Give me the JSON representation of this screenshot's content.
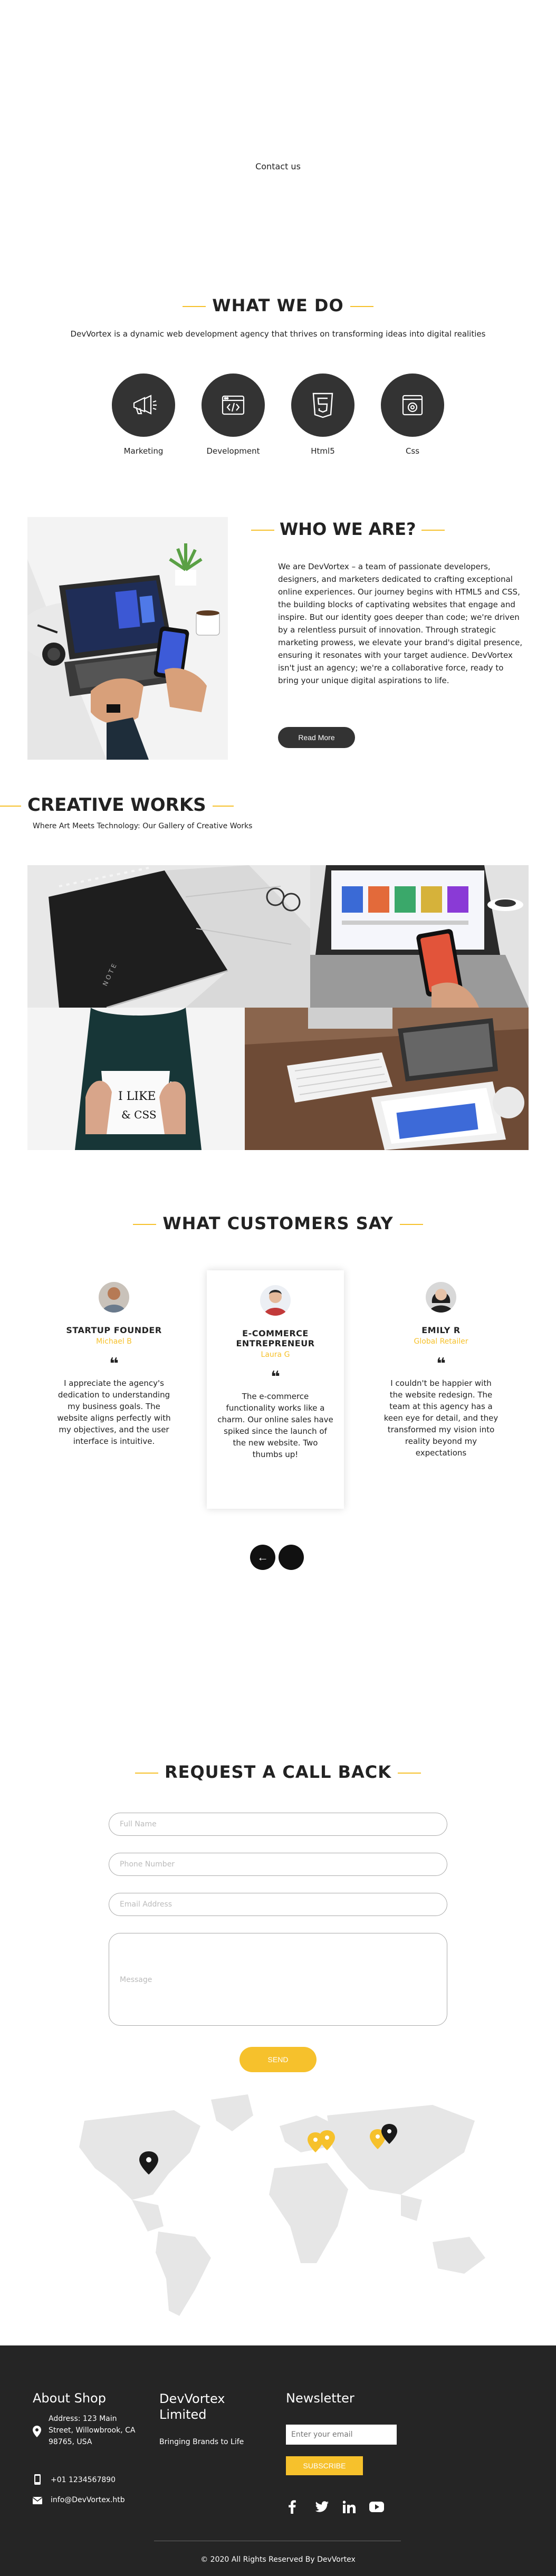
{
  "hero": {
    "contact_link": "Contact us"
  },
  "what_we_do": {
    "title": "WHAT WE DO",
    "subtitle": "DevVortex is a dynamic web development agency that thrives on transforming ideas into digital realities",
    "services": [
      {
        "label": "Marketing",
        "icon": "megaphone-icon"
      },
      {
        "label": "Development",
        "icon": "code-window-icon"
      },
      {
        "label": "Html5",
        "icon": "html5-icon"
      },
      {
        "label": "Css",
        "icon": "css-icon"
      }
    ]
  },
  "who_we_are": {
    "title": "WHO WE ARE?",
    "body": "We are DevVortex – a team of passionate developers, designers, and marketers dedicated to crafting exceptional online experiences. Our journey begins with HTML5 and CSS, the building blocks of captivating websites that engage and inspire. But our identity goes deeper than code; we're driven by a relentless pursuit of innovation. Through strategic marketing prowess, we elevate your brand's digital presence, ensuring it resonates with your target audience. DevVortex isn't just an agency; we're a collaborative force, ready to bring your unique digital aspirations to life.",
    "button": "Read More"
  },
  "creative_works": {
    "title": "CREATIVE WORKS",
    "subtitle": "Where Art Meets Technology: Our Gallery of Creative Works"
  },
  "testimonials": {
    "title": "WHAT CUSTOMERS SAY",
    "items": [
      {
        "role": "STARTUP FOUNDER",
        "name": "Michael B",
        "quote_mark": "❝",
        "text": "I appreciate the agency's dedication to understanding my business goals. The website aligns perfectly with my objectives, and the user interface is intuitive."
      },
      {
        "role": "E-COMMERCE ENTREPRENEUR",
        "name": "Laura G",
        "quote_mark": "❝",
        "text": "The e-commerce functionality works like a charm. Our online sales have spiked since the launch of the new website. Two thumbs up!"
      },
      {
        "role": "EMILY R",
        "name": "Global Retailer",
        "quote_mark": "❝",
        "text": "I couldn't be happier with the website redesign. The team at this agency has a keen eye for detail, and they transformed my vision into reality beyond my expectations"
      }
    ],
    "prev_label": "←",
    "next_label": ""
  },
  "callback": {
    "title": "REQUEST A CALL BACK",
    "full_name_placeholder": "Full Name",
    "phone_placeholder": "Phone Number",
    "email_placeholder": "Email Address",
    "message_placeholder": "Message",
    "send_label": "SEND"
  },
  "footer": {
    "about_title": "About Shop",
    "address": "Address: 123 Main Street, Willowbrook, CA 98765, USA",
    "phone": "+01 1234567890",
    "email": "info@DevVortex.htb",
    "brand_title": "DevVortex Limited",
    "brand_tagline": "Bringing Brands to Life",
    "newsletter_title": "Newsletter",
    "newsletter_placeholder": "Enter your email",
    "subscribe_label": "SUBSCRIBE",
    "copyright": "© 2020 All Rights Reserved By DevVortex"
  },
  "colors": {
    "accent": "#f6c12c",
    "dark": "#333333",
    "footer_bg": "#252525"
  }
}
